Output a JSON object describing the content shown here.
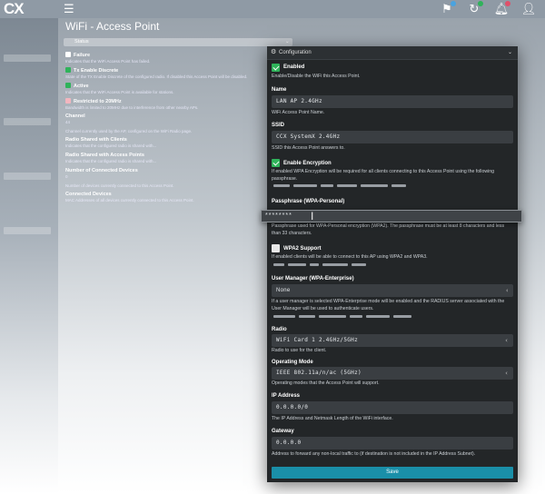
{
  "header": {
    "logo": "CX",
    "menu_icon": "hamburger-icon",
    "icons": [
      {
        "name": "flag-icon",
        "badge_color": "#4aa3df"
      },
      {
        "name": "refresh-icon",
        "badge_color": "#2fb35a"
      },
      {
        "name": "bell-icon",
        "badge_color": "#e0506a"
      },
      {
        "name": "user-icon",
        "badge_color": ""
      }
    ]
  },
  "page": {
    "title": "WiFi - Access Point",
    "status_label": "Status"
  },
  "background": {
    "rows": [
      {
        "title": "Failure",
        "desc": "Indicates that the WiFi Access Point has failed.",
        "check": "#ffffff"
      },
      {
        "title": "Tx Enable Discrete",
        "desc": "State of the TX Enable Discrete of the configured radio. If disabled this Access Point will be disabled.",
        "check": "#2fb35a"
      },
      {
        "title": "Active",
        "desc": "Indicates that the WiFi Access Point is available for stations.",
        "check": "#2fb35a"
      },
      {
        "title": "Restricted to 20MHz",
        "desc": "Bandwidth is limited to 20MHz due to interference from other nearby APs.",
        "check": "#f2b6bf"
      },
      {
        "title": "Channel",
        "desc": "44",
        "check": ""
      },
      {
        "title": "",
        "desc": "Channel currently used by the AP, configured on the WiFi Radio page.",
        "check": ""
      },
      {
        "title": "Radio Shared with Clients",
        "desc": "Indicates that the configured radio is shared with...",
        "check": ""
      },
      {
        "title": "Radio Shared with Access Points",
        "desc": "Indicates that the configured radio is shared with...",
        "check": ""
      },
      {
        "title": "Number of Connected Devices",
        "desc": "0",
        "check": ""
      },
      {
        "title": "",
        "desc": "Number of devices currently connected to this Access Point.",
        "check": ""
      },
      {
        "title": "Connected Devices",
        "desc": "MAC Addresses of all devices currently connected to this Access Point.",
        "check": ""
      }
    ]
  },
  "config": {
    "header_title": "Configuration",
    "enabled": {
      "label": "Enabled",
      "help": "Enable/Disable the WiFi this Access Point.",
      "checked": true
    },
    "name": {
      "label": "Name",
      "value": "LAN AP 2.4GHz",
      "help": "WiFi Access Point Name."
    },
    "ssid": {
      "label": "SSID",
      "value": "CCX SystemX 2.4GHz",
      "help": "SSID this Access Point answers to."
    },
    "encryption": {
      "label": "Enable Encryption",
      "help": "If enabled WPA Encryption will be required for all clients connecting to this Access Point using the following passphrase.",
      "checked": true
    },
    "passphrase": {
      "label": "Passphrase (WPA-Personal)",
      "value": "********",
      "help": "Passphrase used for WPA-Personal encryption (WPA2). The passphrase must be at least 8 characters and less than 33 characters."
    },
    "wpa2": {
      "label": "WPA2 Support",
      "help": "If enabled clients will be able to connect to this AP using WPA2 and WPA3.",
      "checked": false
    },
    "user_manager": {
      "label": "User Manager (WPA-Enterprise)",
      "value": "None",
      "help": "If a user manager is selected WPA-Enterprise mode will be enabled and the RADIUS server associated with the User Manager will be used to authenticate users."
    },
    "radio": {
      "label": "Radio",
      "value": "WiFi Card 1 2.4GHz/5GHz",
      "help": "Radio to use for the client."
    },
    "operating_mode": {
      "label": "Operating Mode",
      "value": "IEEE 802.11a/n/ac (5GHz)",
      "help": "Operating modes that the Access Point will support."
    },
    "ip_address": {
      "label": "IP Address",
      "value": "0.0.0.0/0",
      "help": "The IP Address and Netmask Length of the WiFi interface."
    },
    "gateway": {
      "label": "Gateway",
      "value": "0.0.0.0",
      "help": "Address to forward any non-local traffic to (if destination is not included in the IP Address Subnet)."
    },
    "save_label": "Save"
  },
  "colors": {
    "panel_bg": "#232628",
    "field_bg": "#3a3e42",
    "accent": "#1a8fa8",
    "check_on": "#2fb35a"
  }
}
